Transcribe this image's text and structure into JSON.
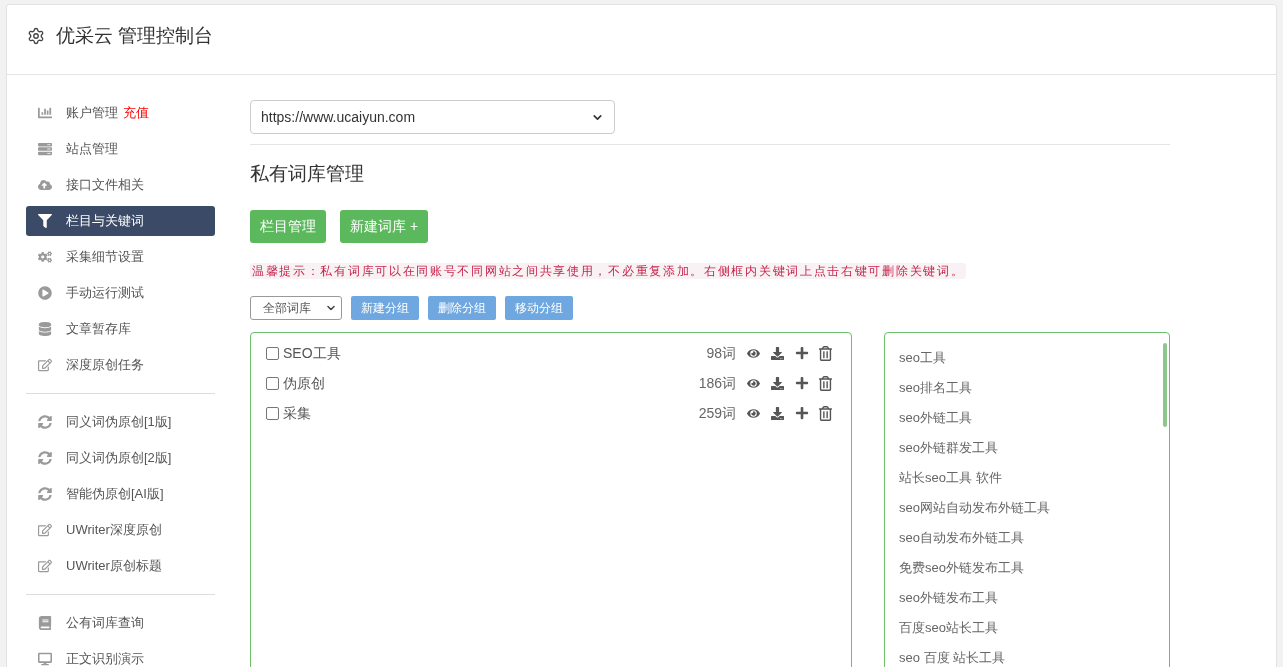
{
  "header": {
    "title": "优采云 管理控制台"
  },
  "sidebar": {
    "groups": [
      {
        "items": [
          {
            "label": "账户管理",
            "badge": "充值",
            "selected": false
          },
          {
            "label": "站点管理",
            "selected": false
          },
          {
            "label": "接口文件相关",
            "selected": false
          },
          {
            "label": "栏目与关键词",
            "selected": true
          },
          {
            "label": "采集细节设置",
            "selected": false
          },
          {
            "label": "手动运行测试",
            "selected": false
          },
          {
            "label": "文章暂存库",
            "selected": false
          },
          {
            "label": "深度原创任务",
            "selected": false
          }
        ]
      },
      {
        "items": [
          {
            "label": "同义词伪原创[1版]",
            "selected": false
          },
          {
            "label": "同义词伪原创[2版]",
            "selected": false
          },
          {
            "label": "智能伪原创[AI版]",
            "selected": false
          },
          {
            "label": "UWriter深度原创",
            "selected": false
          },
          {
            "label": "UWriter原创标题",
            "selected": false
          }
        ]
      },
      {
        "items": [
          {
            "label": "公有词库查询",
            "selected": false
          },
          {
            "label": "正文识别演示",
            "selected": false
          }
        ]
      }
    ]
  },
  "site_select": {
    "value": "https://www.ucaiyun.com"
  },
  "section_title": "私有词库管理",
  "action_buttons": [
    "栏目管理",
    "新建词库 +"
  ],
  "hint": "温馨提示：私有词库可以在同账号不同网站之间共享使用，不必重复添加。右侧框内关键词上点击右键可删除关键词。",
  "group_filter": {
    "value": "全部词库"
  },
  "group_buttons": [
    "新建分组",
    "删除分组",
    "移动分组"
  ],
  "word_groups": [
    {
      "name": "SEO工具",
      "checked": false,
      "count": "98词"
    },
    {
      "name": "伪原创",
      "checked": false,
      "count": "186词"
    },
    {
      "name": "采集",
      "checked": false,
      "count": "259词"
    }
  ],
  "keywords": [
    "seo工具",
    "seo排名工具",
    "seo外链工具",
    "seo外链群发工具",
    "站长seo工具 软件",
    "seo网站自动发布外链工具",
    "seo自动发布外链工具",
    "免费seo外链发布工具",
    "seo外链发布工具",
    "百度seo站长工具",
    "seo 百度 站长工具"
  ]
}
